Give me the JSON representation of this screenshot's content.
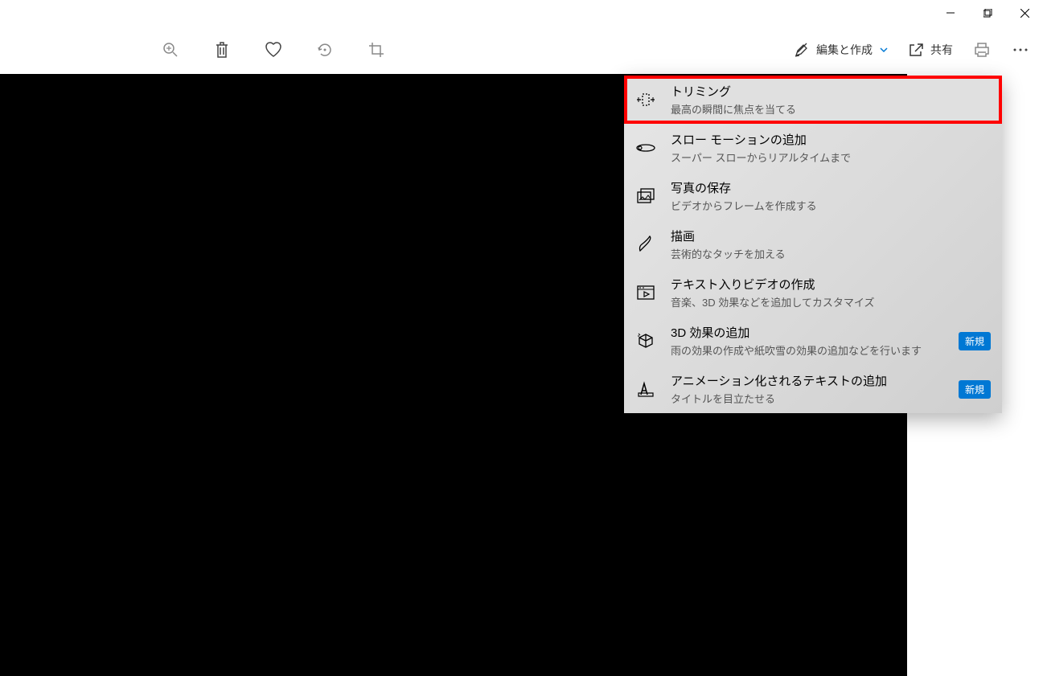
{
  "titlebar": {
    "minimize": "—",
    "maximize": "❐",
    "close": "✕"
  },
  "toolbar": {
    "edit_create_label": "編集と作成",
    "share_label": "共有"
  },
  "menu": {
    "items": [
      {
        "title": "トリミング",
        "desc": "最高の瞬間に焦点を当てる",
        "badge": ""
      },
      {
        "title": "スロー モーションの追加",
        "desc": "スーパー スローからリアルタイムまで",
        "badge": ""
      },
      {
        "title": "写真の保存",
        "desc": "ビデオからフレームを作成する",
        "badge": ""
      },
      {
        "title": "描画",
        "desc": "芸術的なタッチを加える",
        "badge": ""
      },
      {
        "title": "テキスト入りビデオの作成",
        "desc": "音楽、3D 効果などを追加してカスタマイズ",
        "badge": ""
      },
      {
        "title": "3D 効果の追加",
        "desc": "雨の効果の作成や紙吹雪の効果の追加などを行います",
        "badge": "新規"
      },
      {
        "title": "アニメーション化されるテキストの追加",
        "desc": "タイトルを目立たせる",
        "badge": "新規"
      }
    ]
  }
}
